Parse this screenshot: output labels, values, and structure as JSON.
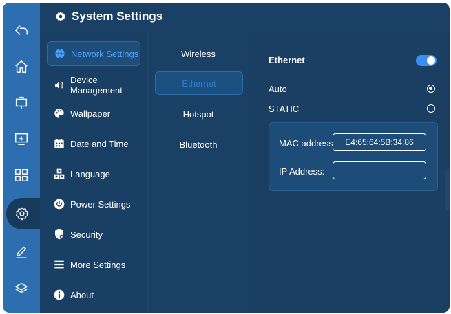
{
  "rail": {
    "items": [
      {
        "icon": "back-icon"
      },
      {
        "icon": "home-icon"
      },
      {
        "icon": "whiteboard-icon"
      },
      {
        "icon": "screen-share-icon"
      },
      {
        "icon": "apps-grid-icon"
      },
      {
        "icon": "settings-gear-icon",
        "active": true
      },
      {
        "icon": "annotate-pen-icon"
      },
      {
        "icon": "layers-icon"
      }
    ]
  },
  "header": {
    "title": "System Settings",
    "icon": "gear-icon"
  },
  "menu": {
    "items": [
      {
        "label": "Network Settings",
        "icon": "globe-icon",
        "active": true
      },
      {
        "label": "Device Management",
        "icon": "speaker-icon"
      },
      {
        "label": "Wallpaper",
        "icon": "palette-icon"
      },
      {
        "label": "Date and Time",
        "icon": "calendar-icon"
      },
      {
        "label": "Language",
        "icon": "language-icon"
      },
      {
        "label": "Power Settings",
        "icon": "power-icon"
      },
      {
        "label": "Security",
        "icon": "shield-icon"
      },
      {
        "label": "More Settings",
        "icon": "list-icon"
      },
      {
        "label": "About",
        "icon": "info-icon"
      }
    ]
  },
  "network_tabs": {
    "items": [
      {
        "label": "Wireless"
      },
      {
        "label": "Ethernet",
        "active": true
      },
      {
        "label": "Hotspot"
      },
      {
        "label": "Bluetooth"
      }
    ]
  },
  "ethernet": {
    "title": "Ethernet",
    "enabled": true,
    "options": [
      {
        "label": "Auto",
        "selected": true
      },
      {
        "label": "STATIC",
        "selected": false
      }
    ],
    "mac_label": "MAC address",
    "mac_value": "E4:65:64:5B:34:86",
    "ip_label": "IP Address:",
    "ip_value": ""
  },
  "colors": {
    "rail": "#2c6eb0",
    "background": "#173a5c",
    "accent": "#3b8ef2",
    "active_text": "#4aa3ff"
  }
}
